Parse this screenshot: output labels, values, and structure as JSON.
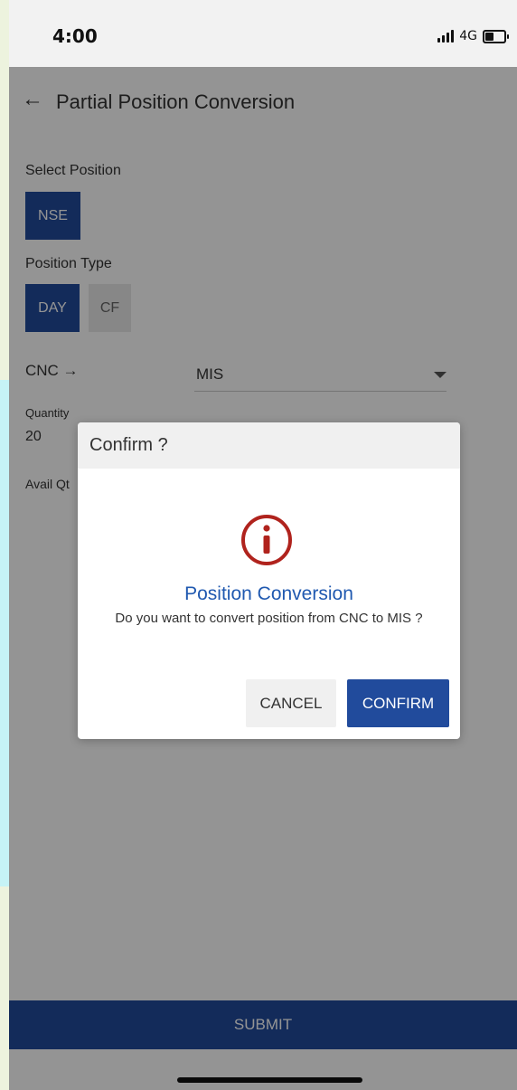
{
  "status_bar": {
    "time": "4:00",
    "network": "4G",
    "signal_icon": "signal-bars-icon",
    "battery_icon": "battery-icon"
  },
  "header": {
    "back_icon": "back-arrow-icon",
    "title": "Partial Position Conversion"
  },
  "form": {
    "select_position_label": "Select Position",
    "exchange_options": [
      "NSE"
    ],
    "position_type_label": "Position Type",
    "position_types": [
      "DAY",
      "CF"
    ],
    "selected_position_type": "DAY",
    "from_product": "CNC →",
    "to_product": "MIS",
    "quantity_label": "Quantity",
    "quantity_value": "20",
    "avail_qty_label": "Avail Qt"
  },
  "submit_label": "SUBMIT",
  "dialog": {
    "title": "Confirm ?",
    "icon": "info-icon",
    "heading": "Position Conversion",
    "message": "Do you want to convert position from CNC to MIS ?",
    "cancel_label": "CANCEL",
    "confirm_label": "CONFIRM"
  },
  "colors": {
    "primary": "#214b9c",
    "link_blue": "#2059b0",
    "icon_red": "#b0231d"
  }
}
